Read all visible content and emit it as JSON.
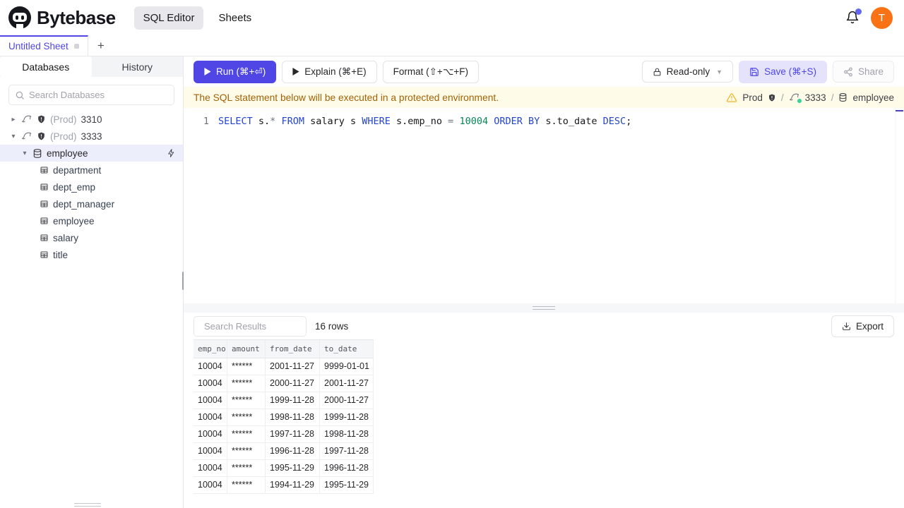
{
  "header": {
    "brand": "Bytebase",
    "nav": [
      {
        "label": "SQL Editor"
      },
      {
        "label": "Sheets"
      }
    ],
    "avatar_initial": "T"
  },
  "sheet_tabs": {
    "active_tab": "Untitled Sheet",
    "add_label": "+"
  },
  "sidebar": {
    "tabs": [
      {
        "label": "Databases"
      },
      {
        "label": "History"
      }
    ],
    "search_placeholder": "Search Databases",
    "tree": {
      "instances": [
        {
          "env": "(Prod)",
          "name": "3310"
        },
        {
          "env": "(Prod)",
          "name": "3333"
        }
      ],
      "database": {
        "name": "employee"
      },
      "tables": [
        "department",
        "dept_emp",
        "dept_manager",
        "employee",
        "salary",
        "title"
      ]
    }
  },
  "toolbar": {
    "run_label": "Run (⌘+⏎)",
    "explain_label": "Explain (⌘+E)",
    "format_label": "Format (⇧+⌥+F)",
    "readonly_label": "Read-only",
    "save_label": "Save (⌘+S)",
    "share_label": "Share"
  },
  "banner": {
    "message": "The SQL statement below will be executed in a protected environment.",
    "environment": "Prod",
    "instance": "3333",
    "separator": "/",
    "database": "employee"
  },
  "editor": {
    "line_number": "1",
    "tokens": [
      {
        "text": "SELECT",
        "type": "keyword"
      },
      {
        "text": " s.",
        "type": "ident"
      },
      {
        "text": "*",
        "type": "operator"
      },
      {
        "text": " ",
        "type": "ident"
      },
      {
        "text": "FROM",
        "type": "keyword"
      },
      {
        "text": " salary s ",
        "type": "ident"
      },
      {
        "text": "WHERE",
        "type": "keyword"
      },
      {
        "text": " s.emp_no ",
        "type": "ident"
      },
      {
        "text": "=",
        "type": "operator"
      },
      {
        "text": " ",
        "type": "ident"
      },
      {
        "text": "10004",
        "type": "number"
      },
      {
        "text": " ",
        "type": "ident"
      },
      {
        "text": "ORDER BY",
        "type": "keyword"
      },
      {
        "text": " s.to_date ",
        "type": "ident"
      },
      {
        "text": "DESC",
        "type": "keyword"
      },
      {
        "text": ";",
        "type": "ident"
      }
    ]
  },
  "results": {
    "search_placeholder": "Search Results",
    "row_count": "16 rows",
    "export_label": "Export",
    "columns": [
      "emp_no",
      "amount",
      "from_date",
      "to_date"
    ],
    "rows": [
      [
        "10004",
        "******",
        "2001-11-27",
        "9999-01-01"
      ],
      [
        "10004",
        "******",
        "2000-11-27",
        "2001-11-27"
      ],
      [
        "10004",
        "******",
        "1999-11-28",
        "2000-11-27"
      ],
      [
        "10004",
        "******",
        "1998-11-28",
        "1999-11-28"
      ],
      [
        "10004",
        "******",
        "1997-11-28",
        "1998-11-28"
      ],
      [
        "10004",
        "******",
        "1996-11-28",
        "1997-11-28"
      ],
      [
        "10004",
        "******",
        "1995-11-29",
        "1996-11-28"
      ],
      [
        "10004",
        "******",
        "1994-11-29",
        "1995-11-29"
      ]
    ]
  },
  "colors": {
    "accent": "#4f46e5",
    "avatar": "#f97316",
    "banner_bg": "#fefce8",
    "banner_text": "#a16207",
    "keyword": "#2444d0",
    "number": "#098658",
    "selected_row_bg": "#eceefb"
  }
}
